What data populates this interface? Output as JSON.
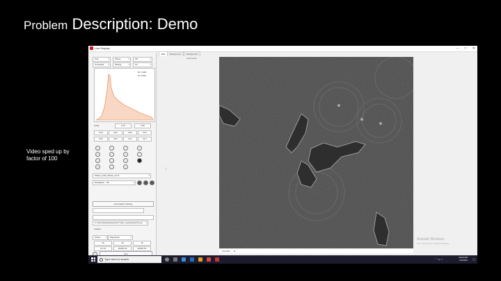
{
  "slide": {
    "title_part1": "Problem",
    "title_part2": "Description: Demo",
    "note": "Video sped up by factor of 100"
  },
  "app": {
    "window_title": "Live Display",
    "panel": {
      "row1": [
        "Cell",
        "Phase",
        "Off"
      ],
      "row2": [
        "Untreated",
        "Setting",
        "On"
      ],
      "hist_stats": [
        "Mi: 0.000",
        "M: 0.000"
      ],
      "range_label": "Scale",
      "range_values": [
        "0.10",
        "0.30"
      ],
      "grid_values": [
        "30.0",
        "30.0",
        "30.0",
        "30.0",
        "30.0",
        "30.0",
        "30.1",
        "30.1"
      ],
      "file_name": "Phase_Cells_Phase_01.tif",
      "navigation_label": "Navigation - Off",
      "automated_tracking_button": "Automated Tracking",
      "path_value": "C:\\Users\\lab\\Desktop\\Cell Track_settings\\batch.json",
      "caption_label": "Caption",
      "bottom_selects": [
        "Phase",
        "Magnitude"
      ],
      "bottom_values": [
        [
          "40",
          "30",
          "30"
        ],
        [
          "0.0.10",
          "20000.00",
          "20000.00"
        ]
      ],
      "exit_label": "Exit"
    },
    "tabs": [
      "Edit",
      "Background",
      "Background Subtraction"
    ],
    "zoom_text": "100.00%",
    "watermark_title": "Activate Windows",
    "watermark_sub": "Go to Settings to activate Windows.",
    "taskbar": {
      "search_placeholder": "Type here to search",
      "time": "10:04 PM",
      "date": "2/1/2022"
    }
  }
}
